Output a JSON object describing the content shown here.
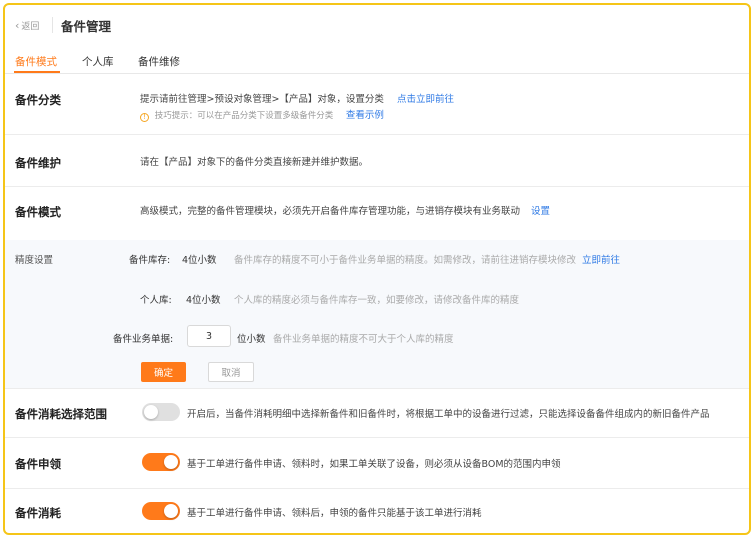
{
  "header": {
    "back_label": "返回",
    "title": "备件管理"
  },
  "tabs": [
    {
      "label": "备件模式",
      "active": true
    },
    {
      "label": "个人库",
      "active": false
    },
    {
      "label": "备件维修",
      "active": false
    }
  ],
  "category": {
    "label": "备件分类",
    "text": "提示请前往管理>预设对象管理>【产品】对象，设置分类",
    "link": "点击立即前往",
    "tip": "技巧提示：可以在产品分类下设置多级备件分类",
    "tip_link": "查看示例"
  },
  "maintenance": {
    "label": "备件维护",
    "text": "请在【产品】对象下的备件分类直接新建并维护数据。"
  },
  "mode": {
    "label": "备件模式",
    "text": "高级模式，完整的备件管理模块，必须先开启备件库存管理功能，与进销存模块有业务联动",
    "link": "设置"
  },
  "precision": {
    "title": "精度设置",
    "inventory_label": "备件库存:",
    "inventory_value": "4位小数",
    "inventory_desc": "备件库存的精度不可小于备件业务单据的精度。如需修改，请前往进销存模块修改",
    "inventory_link": "立即前往",
    "personal_label": "个人库:",
    "personal_value": "4位小数",
    "personal_desc": "个人库的精度必须与备件库存一致，如要修改，请修改备件库的精度",
    "docs_label": "备件业务单据:",
    "docs_input_value": "3",
    "docs_unit": "位小数",
    "docs_desc": "备件业务单据的精度不可大于个人库的精度",
    "ok_label": "确定",
    "cancel_label": "取消"
  },
  "consumption_scope": {
    "label": "备件消耗选择范围",
    "enabled": false,
    "text": "开启后，当备件消耗明细中选择新备件和旧备件时，将根据工单中的设备进行过滤，只能选择设备备件组成内的新旧备件产品"
  },
  "requisition": {
    "label": "备件申领",
    "enabled": true,
    "text": "基于工单进行备件申请、领料时，如果工单关联了设备，则必须从设备BOM的范围内申领"
  },
  "consumption": {
    "label": "备件消耗",
    "enabled": true,
    "text": "基于工单进行备件申请、领料后，申领的备件只能基于该工单进行消耗"
  },
  "colors": {
    "accent": "#ff7a1a",
    "link": "#2f7ae5",
    "frame": "#f5c518"
  }
}
